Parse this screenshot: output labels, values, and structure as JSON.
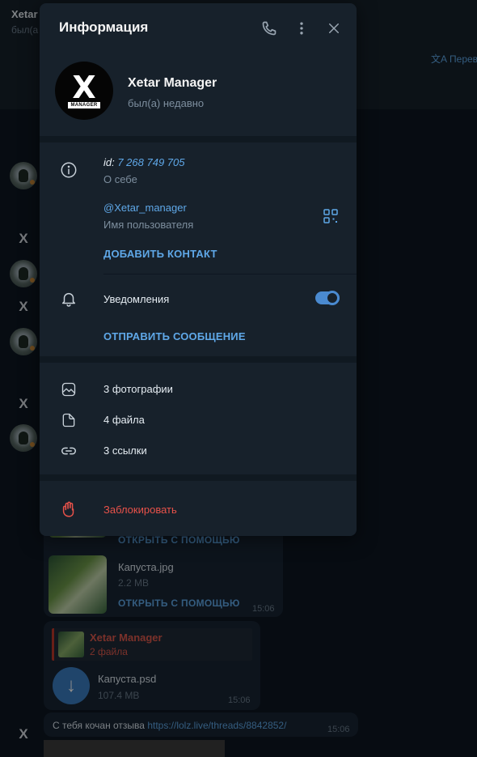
{
  "background_chat": {
    "header_title": "Xetar",
    "header_status": "был(а",
    "translate_label": "Перев",
    "files_bubble": {
      "open_label_top": "ОТКРЫТЬ С ПОМОЩЬЮ",
      "file_name": "Капуста.jpg",
      "file_size": "2.2 MB",
      "open_label": "ОТКРЫТЬ С ПОМОЩЬЮ",
      "time": "15:06"
    },
    "reply_bubble": {
      "quote_name": "Xetar Manager",
      "quote_text": "2 файла",
      "file_name": "Капуста.psd",
      "file_size": "107.4 MB",
      "time": "15:06"
    },
    "text_bubble": {
      "text": "С тебя кочан отзыва ",
      "link": "https://lolz.live/threads/8842852/",
      "time": "15:06"
    }
  },
  "info_panel": {
    "title": "Информация",
    "profile": {
      "avatar_logo_text": "X",
      "avatar_logo_caption": "MANAGER",
      "name": "Xetar Manager",
      "status": "был(а) недавно"
    },
    "about": {
      "id_prefix": "id: ",
      "id_value": "7 268 749 705",
      "id_caption": "О себе",
      "username": "@Xetar_manager",
      "username_caption": "Имя пользователя",
      "add_contact": "ДОБАВИТЬ КОНТАКТ"
    },
    "notifications": {
      "label": "Уведомления",
      "enabled": true,
      "send_message": "ОТПРАВИТЬ СООБЩЕНИЕ"
    },
    "media": {
      "photos": "3 фотографии",
      "files": "4 файла",
      "links": "3 ссылки"
    },
    "block_label": "Заблокировать"
  },
  "colors": {
    "accent": "#5fa8e8",
    "danger": "#e8524a",
    "toggle": "#4a8ad0",
    "panel_bg": "#17212b"
  },
  "icons": {
    "call": "phone-icon",
    "menu": "more-vertical-icon",
    "close": "close-icon",
    "info": "info-icon",
    "qr": "qr-code-icon",
    "bell": "bell-icon",
    "photo": "photo-icon",
    "file": "file-icon",
    "link": "link-icon",
    "block": "hand-stop-icon"
  }
}
